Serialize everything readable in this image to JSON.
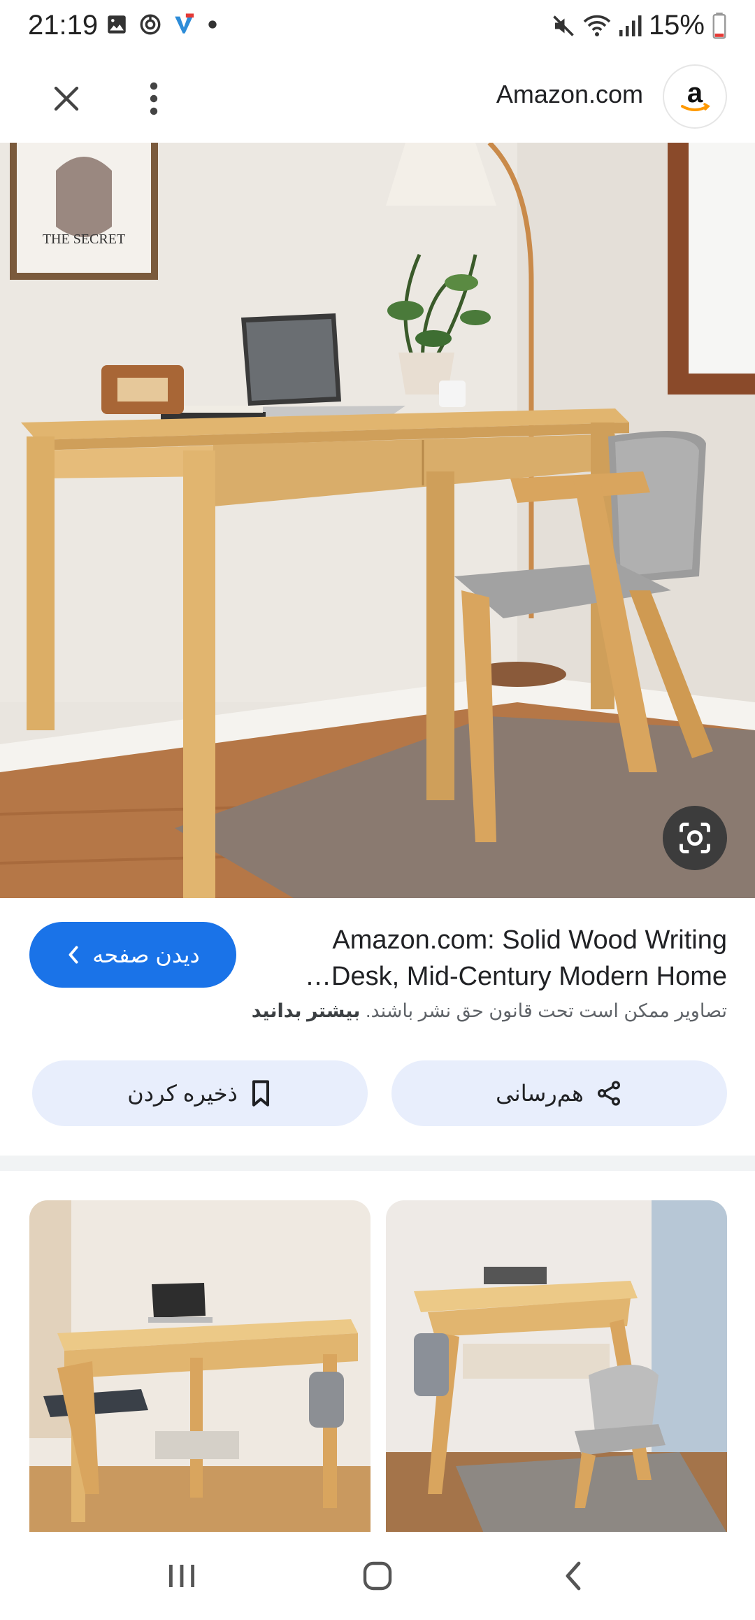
{
  "status_bar": {
    "time": "21:19",
    "battery": "15%",
    "left_icons": [
      "gallery-icon",
      "sync-icon",
      "vpn-icon",
      "dot-icon"
    ],
    "right_icons": [
      "mute-icon",
      "wifi-icon",
      "signal-icon",
      "battery-icon"
    ]
  },
  "toolbar": {
    "site_name": "Amazon.com",
    "logo_letter": "a"
  },
  "result": {
    "title_line1": "Amazon.com: Solid Wood Writing",
    "title_line2": "…Desk, Mid-Century Modern Home",
    "visit_label": "دیدن صفحه",
    "copyright_text": "تصاویر ممکن است تحت قانون حق نشر باشند.",
    "learn_more": "بیشتر بدانید",
    "share_label": "هم‌رسانی",
    "save_label": "ذخیره کردن"
  },
  "colors": {
    "accent": "#1a73e8",
    "chip_bg": "#e8eefc"
  }
}
